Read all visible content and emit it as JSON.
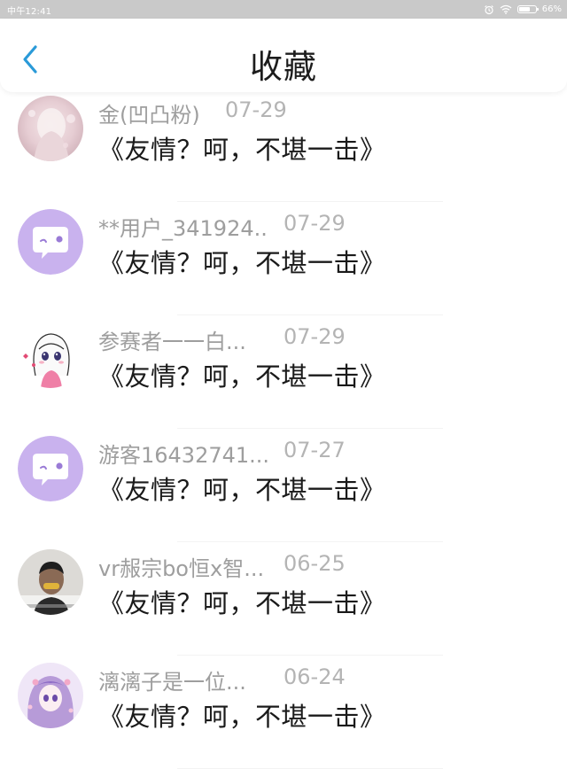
{
  "status_bar": {
    "time": "中午12:41",
    "battery": "66%",
    "battery_level": 0.66
  },
  "header": {
    "title": "收藏",
    "back_icon": "chevron-left-icon",
    "accent_color": "#2a9ad8"
  },
  "favorites": [
    {
      "user": "金(凹凸粉)",
      "date": "07-29",
      "title": "《友情？呵，不堪一击》",
      "avatar": "photo-avatar-pink"
    },
    {
      "user": "**用户_341924..",
      "date": "07-29",
      "title": "《友情？呵，不堪一击》",
      "avatar": "default-chat-avatar"
    },
    {
      "user": "参赛者一一白...",
      "date": "07-29",
      "title": "《友情？呵，不堪一击》",
      "avatar": "anime-girl-avatar"
    },
    {
      "user": "游客16432741...",
      "date": "07-27",
      "title": "《友情？呵，不堪一击》",
      "avatar": "default-chat-avatar"
    },
    {
      "user": "vr赧宗bo恒x智...",
      "date": "06-25",
      "title": "《友情？呵，不堪一击》",
      "avatar": "photo-avatar-person"
    },
    {
      "user": "漓漓子是一位...",
      "date": "06-24",
      "title": "《友情？呵，不堪一击》",
      "avatar": "anime-girl-purple-avatar"
    }
  ]
}
